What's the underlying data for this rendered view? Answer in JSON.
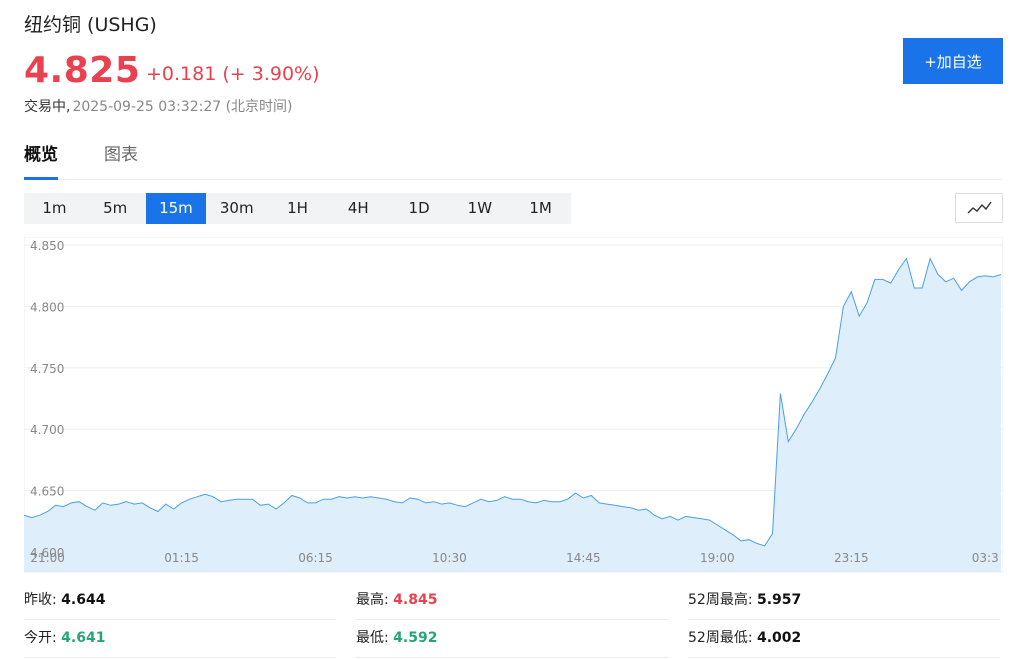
{
  "header": {
    "title": "纽约铜 (USHG)",
    "price": "4.825",
    "change": "+0.181 (+ 3.90%)",
    "status_label": "交易中,",
    "timestamp": "2025-09-25 03:32:27 (北京时间)",
    "add_button": "+加自选"
  },
  "tabs": [
    {
      "label": "概览",
      "active": true
    },
    {
      "label": "图表",
      "active": false
    }
  ],
  "intervals": [
    {
      "label": "1m"
    },
    {
      "label": "5m"
    },
    {
      "label": "15m",
      "active": true
    },
    {
      "label": "30m"
    },
    {
      "label": "1H"
    },
    {
      "label": "4H"
    },
    {
      "label": "1D"
    },
    {
      "label": "1W"
    },
    {
      "label": "1M"
    }
  ],
  "chart_data": {
    "type": "area",
    "ylim": [
      4.6,
      4.85
    ],
    "yticks": [
      "4.850",
      "4.800",
      "4.750",
      "4.700",
      "4.650",
      "4.600"
    ],
    "xticks": [
      {
        "label": "21:00",
        "index": 3
      },
      {
        "label": "01:15",
        "index": 20
      },
      {
        "label": "06:15",
        "index": 37
      },
      {
        "label": "10:30",
        "index": 54
      },
      {
        "label": "14:45",
        "index": 71
      },
      {
        "label": "19:00",
        "index": 88
      },
      {
        "label": "23:15",
        "index": 105
      },
      {
        "label": "03:3",
        "index": 122
      }
    ],
    "line_color": "#4a9fe8",
    "fill_color": "#deeefb",
    "values": [
      4.63,
      4.628,
      4.63,
      4.633,
      4.638,
      4.637,
      4.64,
      4.641,
      4.637,
      4.634,
      4.64,
      4.638,
      4.639,
      4.641,
      4.639,
      4.64,
      4.636,
      4.633,
      4.639,
      4.635,
      4.64,
      4.643,
      4.645,
      4.647,
      4.645,
      4.641,
      4.642,
      4.643,
      4.643,
      4.643,
      4.638,
      4.639,
      4.635,
      4.64,
      4.646,
      4.644,
      4.64,
      4.64,
      4.643,
      4.643,
      4.645,
      4.644,
      4.645,
      4.644,
      4.645,
      4.644,
      4.643,
      4.641,
      4.64,
      4.644,
      4.643,
      4.64,
      4.641,
      4.639,
      4.64,
      4.638,
      4.637,
      4.64,
      4.643,
      4.641,
      4.642,
      4.645,
      4.643,
      4.643,
      4.641,
      4.64,
      4.642,
      4.641,
      4.641,
      4.643,
      4.648,
      4.644,
      4.646,
      4.64,
      4.639,
      4.638,
      4.637,
      4.636,
      4.634,
      4.635,
      4.63,
      4.627,
      4.629,
      4.626,
      4.629,
      4.628,
      4.627,
      4.626,
      4.622,
      4.618,
      4.614,
      4.609,
      4.61,
      4.607,
      4.605,
      4.615,
      4.729,
      4.69,
      4.7,
      4.712,
      4.722,
      4.733,
      4.745,
      4.758,
      4.8,
      4.812,
      4.792,
      4.803,
      4.822,
      4.822,
      4.819,
      4.83,
      4.839,
      4.815,
      4.815,
      4.839,
      4.826,
      4.82,
      4.823,
      4.813,
      4.82,
      4.824,
      4.825,
      4.824,
      4.826
    ]
  },
  "stats": [
    [
      {
        "label": "昨收:",
        "value": "4.644",
        "tone": "plain"
      },
      {
        "label": "最高:",
        "value": "4.845",
        "tone": "up"
      },
      {
        "label": "52周最高:",
        "value": "5.957",
        "tone": "plain"
      }
    ],
    [
      {
        "label": "今开:",
        "value": "4.641",
        "tone": "down"
      },
      {
        "label": "最低:",
        "value": "4.592",
        "tone": "down"
      },
      {
        "label": "52周最低:",
        "value": "4.002",
        "tone": "plain"
      }
    ]
  ],
  "colors": {
    "accent": "#1a73e8",
    "up": "#e9414f",
    "down": "#24a678"
  },
  "icons": {
    "chart_type": "line-chart-icon"
  }
}
